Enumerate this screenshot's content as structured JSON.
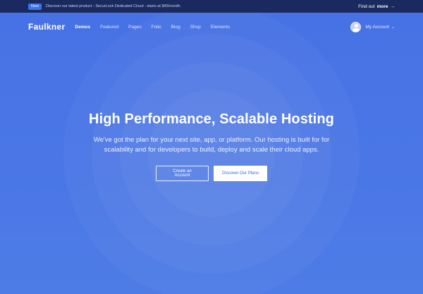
{
  "topbar": {
    "badge": "New",
    "announcement": "Discover our latest product - SecurLock Dedicated Cloud - starts at $45/month.",
    "link_label": "Find out",
    "link_strong": "more",
    "link_arrow": "→"
  },
  "nav": {
    "logo": "Faulkner",
    "items": [
      {
        "label": "Demos",
        "active": true
      },
      {
        "label": "Featured"
      },
      {
        "label": "Pages"
      },
      {
        "label": "Folio"
      },
      {
        "label": "Blog"
      },
      {
        "label": "Shop"
      },
      {
        "label": "Elements"
      }
    ],
    "account_label": "My Account",
    "account_caret": "⌄"
  },
  "hero": {
    "title": "High Performance, Scalable Hosting",
    "subtitle": "We've got the plan for your next site, app, or platform. Our hosting is built for for scalability and for developers to build, deploy and scale their cloud apps.",
    "primary_button": "Create an Account",
    "secondary_button": "Discover Our Plans"
  },
  "colors": {
    "hero_bg": "#4a74e6",
    "topbar_bg": "#1b2a5e",
    "badge_bg": "#3a73f0",
    "button_text": "#3e63d6"
  }
}
